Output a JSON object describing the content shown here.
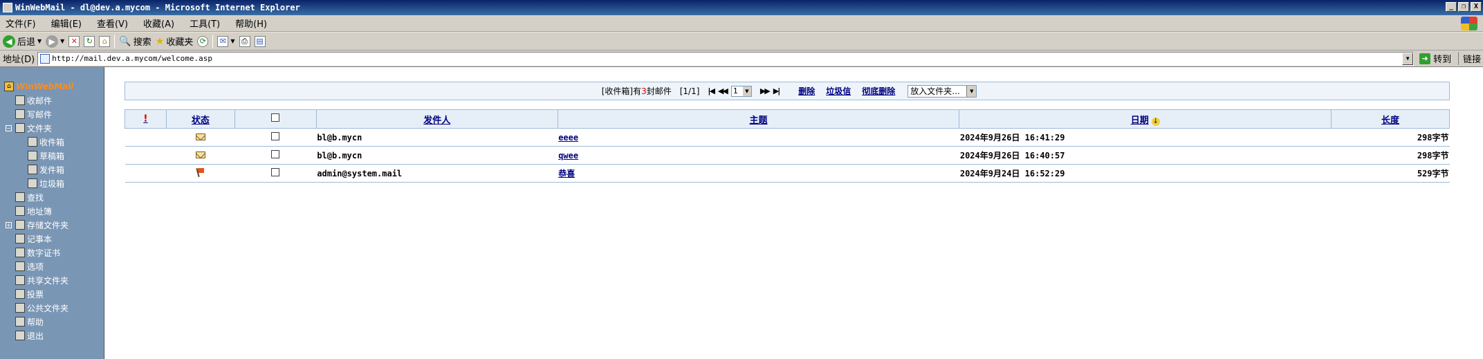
{
  "window": {
    "title": "WinWebMail - dl@dev.a.mycom - Microsoft Internet Explorer",
    "buttons": [
      "_",
      "❐",
      "X"
    ]
  },
  "menubar": {
    "items": [
      "文件(F)",
      "编辑(E)",
      "查看(V)",
      "收藏(A)",
      "工具(T)",
      "帮助(H)"
    ]
  },
  "toolbar": {
    "back_label": "后退",
    "search_label": "搜索",
    "favorites_label": "收藏夹"
  },
  "addressbar": {
    "label": "地址(D)",
    "url": "http://mail.dev.a.mycom/welcome.asp",
    "go_label": "转到",
    "links_label": "链接"
  },
  "sidebar": {
    "root_label": "WinWebMail",
    "items": [
      {
        "label": "收邮件",
        "icon": "inbox-icon"
      },
      {
        "label": "写邮件",
        "icon": "compose-icon"
      },
      {
        "label": "文件夹",
        "icon": "folder-icon"
      },
      {
        "label": "收件箱",
        "icon": "inbox-folder-icon"
      },
      {
        "label": "草稿箱",
        "icon": "drafts-icon"
      },
      {
        "label": "发件箱",
        "icon": "sent-icon"
      },
      {
        "label": "垃圾箱",
        "icon": "trash-icon"
      },
      {
        "label": "查找",
        "icon": "search-icon"
      },
      {
        "label": "地址簿",
        "icon": "address-book-icon"
      },
      {
        "label": "存储文件夹",
        "icon": "storage-folder-icon"
      },
      {
        "label": "记事本",
        "icon": "notepad-icon"
      },
      {
        "label": "数字证书",
        "icon": "certificate-icon"
      },
      {
        "label": "选项",
        "icon": "options-icon"
      },
      {
        "label": "共享文件夹",
        "icon": "shared-folder-icon"
      },
      {
        "label": "投票",
        "icon": "vote-icon"
      },
      {
        "label": "公共文件夹",
        "icon": "public-folder-icon"
      },
      {
        "label": "帮助",
        "icon": "help-icon"
      },
      {
        "label": "退出",
        "icon": "logout-icon"
      }
    ]
  },
  "navbar": {
    "summary_prefix": "[收件箱]有",
    "summary_count": "3",
    "summary_suffix": "封邮件",
    "page_indicator": "[1/1]",
    "first_page": "|◀",
    "prev_page": "◀◀",
    "page_select_value": "1",
    "next_page": "▶▶",
    "last_page": "▶|",
    "delete_label": "删除",
    "spam_label": "垃圾信",
    "purge_label": "彻底删除",
    "move_to_folder_placeholder": "放入文件夹..."
  },
  "mail_table": {
    "headers": {
      "priority": "!",
      "status": "状态",
      "sender": "发件人",
      "subject": "主题",
      "date": "日期",
      "size": "长度"
    },
    "rows": [
      {
        "status_icon": "envelope-icon",
        "sender": "bl@b.mycn",
        "subject": "eeee",
        "date": "2024年9月26日 16:41:29",
        "size": "298字节"
      },
      {
        "status_icon": "envelope-icon",
        "sender": "bl@b.mycn",
        "subject": "qwee",
        "date": "2024年9月26日 16:40:57",
        "size": "298字节"
      },
      {
        "status_icon": "flag-icon",
        "sender": "admin@system.mail",
        "subject": "恭喜",
        "date": "2024年9月24日 16:52:29",
        "size": "529字节"
      }
    ]
  }
}
